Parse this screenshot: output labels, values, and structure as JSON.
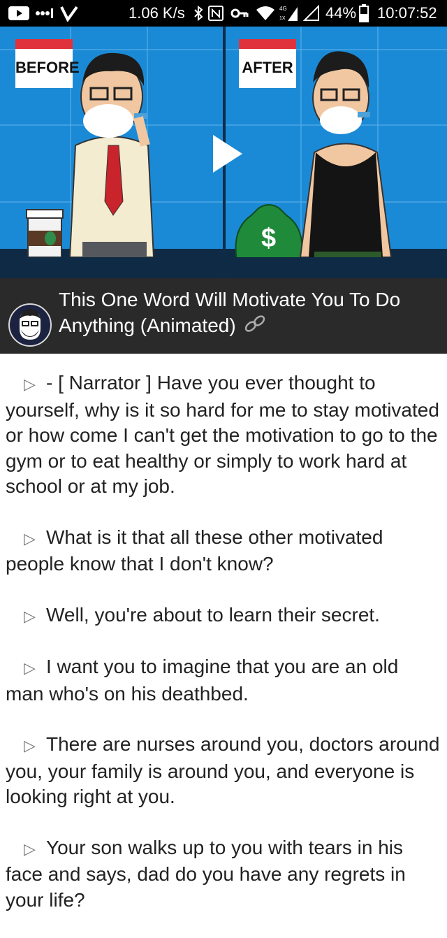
{
  "status_bar": {
    "net_speed": "1.06 K/s",
    "battery": "44%",
    "time": "10:07:52",
    "network_type": "4G"
  },
  "video": {
    "before_label": "BEFORE",
    "after_label": "AFTER"
  },
  "header": {
    "title": "This One Word Will Motivate You To Do Anything (Animated)"
  },
  "transcript": [
    "- [ Narrator ] Have you ever thought to yourself, why is it so hard for me to stay motivated or how come I can't get the motivation to go to the gym or to eat healthy or simply to work hard at school or at my job.",
    "What is it that all these other motivated people know that I don't know?",
    "Well, you're about to learn their secret.",
    "I want you to imagine that you are an old man who's on his deathbed.",
    "There are nurses around you, doctors around you, your family is around you, and everyone is looking right at you.",
    "Your son walks up to you with tears in his face and says, dad do you have any regrets in your life?"
  ],
  "colors": {
    "status_bg": "#000000",
    "video_bg": "#1b8ad6",
    "title_bar_bg": "#2a2a2a",
    "sign_red": "#e0323c"
  }
}
